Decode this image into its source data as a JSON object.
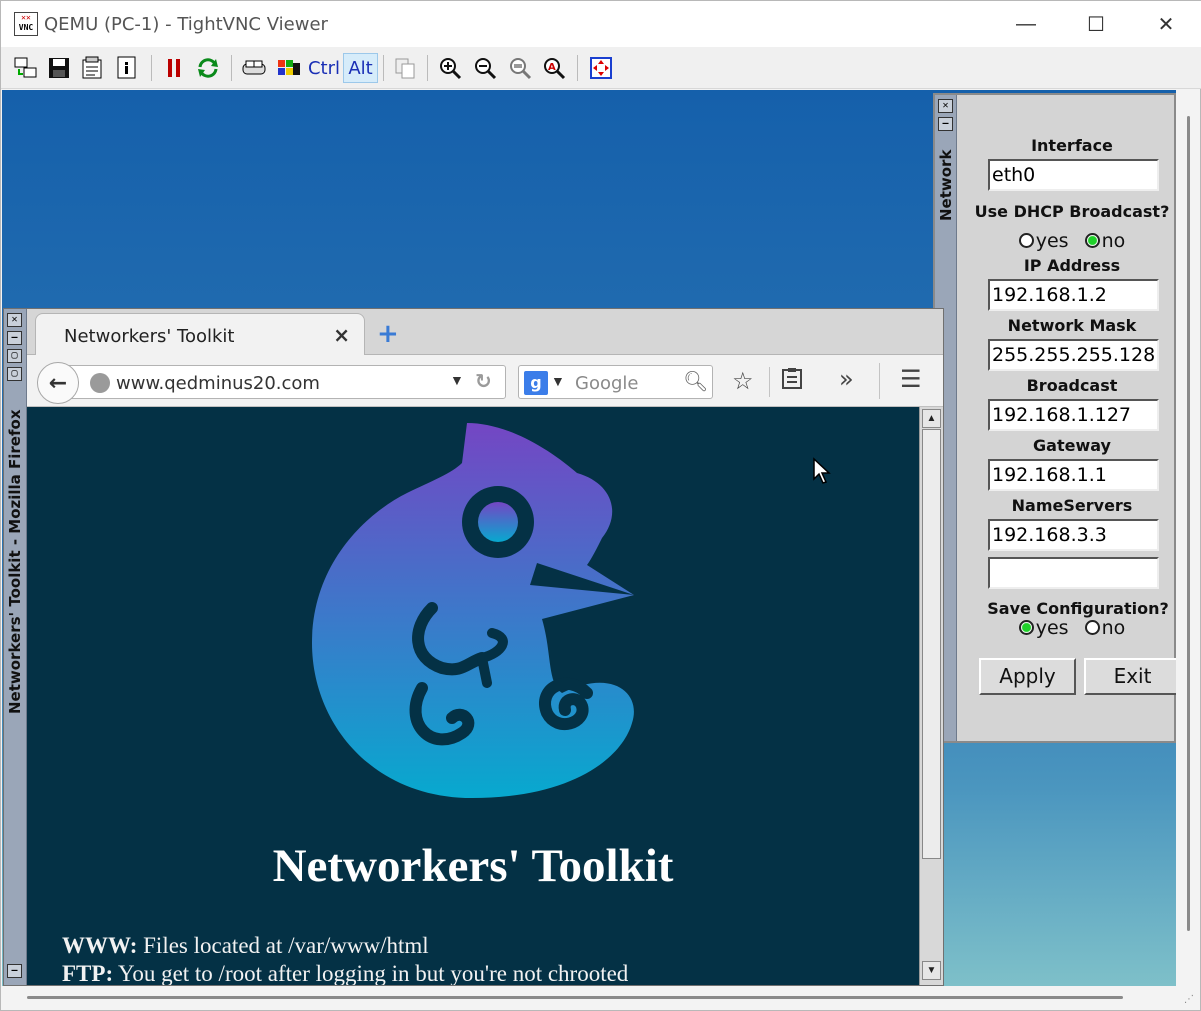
{
  "window": {
    "title": "QEMU (PC-1) - TightVNC Viewer",
    "minimize": "—",
    "maximize": "☐",
    "close": "✕"
  },
  "toolbar": {
    "ctrl_label": "Ctrl",
    "alt_label": "Alt"
  },
  "network_panel": {
    "strip_title": "Network",
    "interface_label": "Interface",
    "interface_value": "eth0",
    "dhcp_label": "Use DHCP Broadcast?",
    "dhcp_yes": "yes",
    "dhcp_no": "no",
    "dhcp_selected": "no",
    "ip_label": "IP Address",
    "ip_value": "192.168.1.2",
    "mask_label": "Network Mask",
    "mask_value": "255.255.255.128",
    "broadcast_label": "Broadcast",
    "broadcast_value": "192.168.1.127",
    "gateway_label": "Gateway",
    "gateway_value": "192.168.1.1",
    "nameservers_label": "NameServers",
    "nameserver1_value": "192.168.3.3",
    "nameserver2_value": "",
    "save_label": "Save Configuration?",
    "save_yes": "yes",
    "save_no": "no",
    "save_selected": "yes",
    "apply_label": "Apply",
    "exit_label": "Exit"
  },
  "firefox": {
    "strip_title": "Networkers' Toolkit - Mozilla Firefox",
    "tab_title": "Networkers' Toolkit",
    "url": "www.qedminus20.com",
    "search_placeholder": "Google",
    "page": {
      "heading": "Networkers' Toolkit",
      "line1_label": "WWW:",
      "line1_text": " Files located at /var/www/html",
      "line2_label": "FTP:",
      "line2_text": " You get to /root after logging in but you're not chrooted"
    }
  },
  "colors": {
    "desktop_top": "#1560ab",
    "page_background": "#043145",
    "logo_top": "#7446c4",
    "logo_bottom": "#07a9cf",
    "radio_selected": "#1fd12a"
  }
}
